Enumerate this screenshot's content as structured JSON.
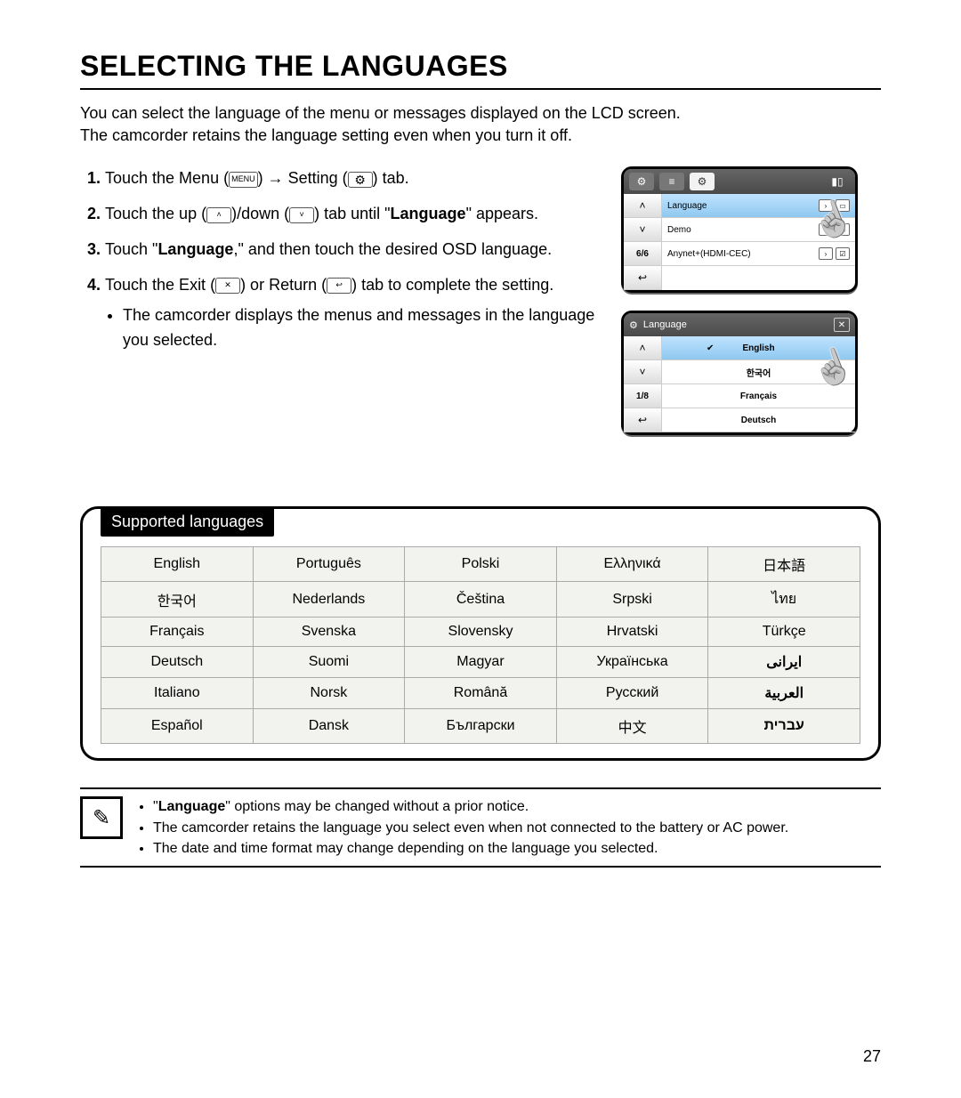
{
  "title": "SELECTING THE LANGUAGES",
  "intro1": "You can select the language of the menu or messages displayed on the LCD screen.",
  "intro2": "The camcorder retains the language setting even when you turn it off.",
  "steps": {
    "s1a": "Touch the Menu (",
    "s1b": ") ",
    "s1c": " Setting (",
    "s1d": ") tab.",
    "menu": "MENU",
    "arrow": "→",
    "s2a": "Touch the up (",
    "s2b": ")/down (",
    "s2c": ") tab until \"",
    "s2d": "\" appears.",
    "lang": "Language",
    "s3a": "Touch \"",
    "s3b": ",\" and then touch the desired OSD language.",
    "s4a": "Touch the Exit (",
    "s4b": ") or Return (",
    "s4c": ") tab to complete the setting.",
    "s4sub": "The camcorder displays the menus and messages in the language you selected."
  },
  "screen1": {
    "page": "6/6",
    "items": [
      "Language",
      "Demo",
      "Anynet+(HDMI-CEC)"
    ]
  },
  "screen2": {
    "title": "Language",
    "page": "1/8",
    "items": [
      "English",
      "한국어",
      "Français",
      "Deutsch"
    ]
  },
  "supported_title": "Supported languages",
  "langs": [
    [
      "English",
      "Português",
      "Polski",
      "Ελληνικά",
      "日本語"
    ],
    [
      "한국어",
      "Nederlands",
      "Čeština",
      "Srpski",
      "ไทย"
    ],
    [
      "Français",
      "Svenska",
      "Slovensky",
      "Hrvatski",
      "Türkçe"
    ],
    [
      "Deutsch",
      "Suomi",
      "Magyar",
      "Українська",
      "ايرانى"
    ],
    [
      "Italiano",
      "Norsk",
      "Română",
      "Русский",
      "العربية"
    ],
    [
      "Español",
      "Dansk",
      "Български",
      "中文",
      "עברית"
    ]
  ],
  "notes": {
    "n1a": "\"",
    "n1b": "\" options may be changed without a prior notice.",
    "n2": "The camcorder retains the language you select even when not connected to the battery or AC power.",
    "n3": "The date and time format may change depending on the language you selected."
  },
  "page_number": "27"
}
